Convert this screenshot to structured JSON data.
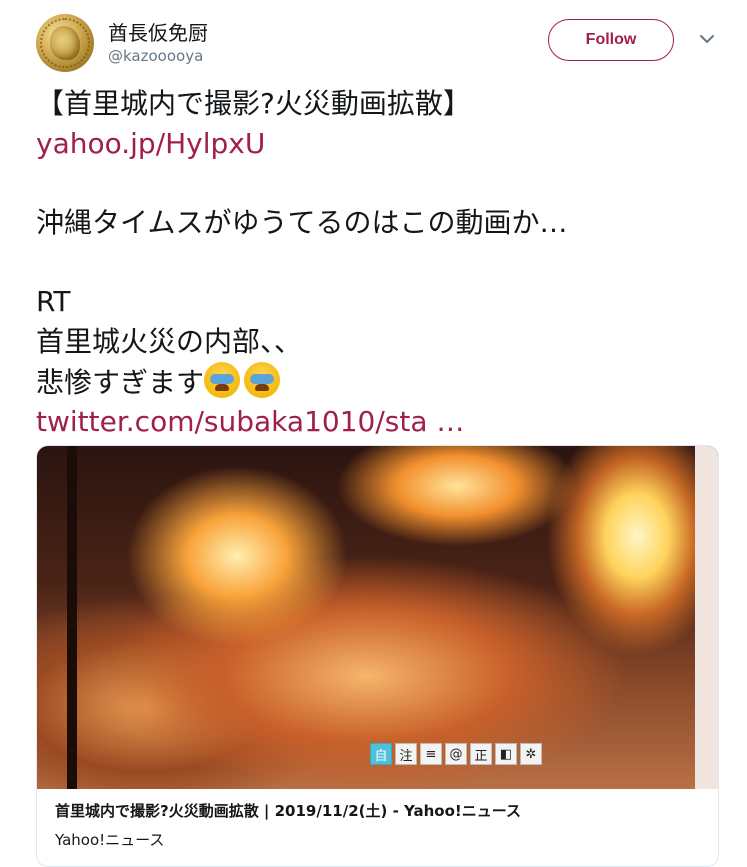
{
  "user": {
    "display_name": "酋長仮免厨",
    "handle": "@kazooooya"
  },
  "actions": {
    "follow_label": "Follow",
    "more_icon": "chevron-down-icon"
  },
  "tweet": {
    "line1": "【首里城内で撮影?火災動画拡散】",
    "link1": "yahoo.jp/HylpxU",
    "line3": "沖縄タイムスがゆうてるのはこの動画か…",
    "line4": " RT",
    "line5": "首里城火災の内部、、",
    "line6": "悲惨すぎます",
    "emoji": "loudly-crying-face",
    "link2": "twitter.com/subaka1010/sta …"
  },
  "card": {
    "title": "首里城内で撮影?火災動画拡散 | 2019/11/2(土) - Yahoo!ニュース",
    "source": "Yahoo!ニュース",
    "toolbar": [
      "自",
      "注",
      "≡",
      "@",
      "正",
      "◧",
      "✲"
    ]
  },
  "colors": {
    "accent": "#a0204c",
    "muted": "#657786"
  }
}
